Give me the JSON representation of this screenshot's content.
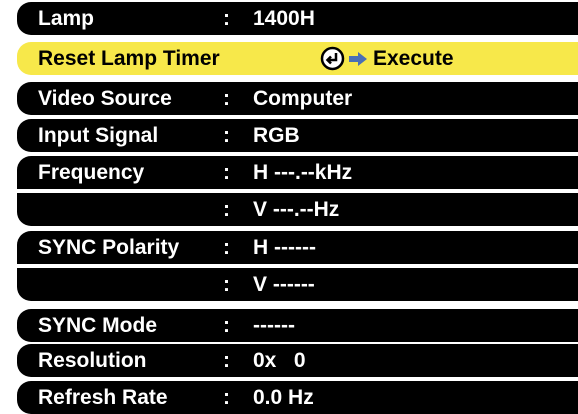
{
  "menu": {
    "rows": [
      {
        "label": "Lamp",
        "colon": ":",
        "value": "1400H"
      },
      {
        "label": "Reset Lamp Timer",
        "action_label": "Execute",
        "icon": "enter-icon",
        "arrow_icon": "arrow-right-icon",
        "highlight": "#f7e84a"
      },
      {
        "label": "Video Source",
        "colon": ":",
        "value": "Computer"
      },
      {
        "label": "Input Signal",
        "colon": ":",
        "value": "RGB"
      },
      {
        "label": "Frequency",
        "colon": ":",
        "value": "H ---.--kHz"
      },
      {
        "label": "",
        "colon": ":",
        "value": "V ---.--Hz"
      },
      {
        "label": "SYNC Polarity",
        "colon": ":",
        "value": "H ------"
      },
      {
        "label": "",
        "colon": ":",
        "value": "V ------"
      },
      {
        "label": "SYNC Mode",
        "colon": ":",
        "value": "------"
      },
      {
        "label": "Resolution",
        "colon": ":",
        "value": "0x   0"
      },
      {
        "label": "Refresh Rate",
        "colon": ":",
        "value": "0.0 Hz"
      }
    ]
  },
  "colors": {
    "row_background": "#000000",
    "text": "#ffffff",
    "selected_row": "#f7e84a",
    "selected_text": "#000000",
    "arrow": "#4a6fb5"
  }
}
